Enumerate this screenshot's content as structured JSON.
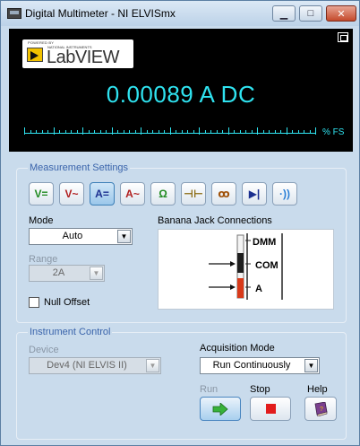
{
  "window": {
    "title": "Digital Multimeter - NI ELVISmx"
  },
  "display": {
    "logo_small": "POWERED BY",
    "logo_sub": "NATIONAL INSTRUMENTS",
    "logo_text": "LabVIEW",
    "reading": "0.00089 A DC",
    "fs_label": "% FS"
  },
  "measurement": {
    "title": "Measurement Settings",
    "buttons": [
      {
        "label": "V=",
        "color": "#1f8a1f"
      },
      {
        "label": "V~",
        "color": "#b01e1e"
      },
      {
        "label": "A=",
        "color": "#1b2f8f"
      },
      {
        "label": "A~",
        "color": "#b01e1e"
      },
      {
        "label": "Ω",
        "color": "#1f8a1f"
      },
      {
        "label": "⊣⊢",
        "color": "#8a6a10"
      },
      {
        "label": "ꝏ",
        "color": "#a0520a"
      },
      {
        "label": "▶|",
        "color": "#1b2f8f"
      },
      {
        "label": "·))",
        "color": "#2a7fd6"
      }
    ],
    "active_index": 2,
    "mode_label": "Mode",
    "mode_value": "Auto",
    "range_label": "Range",
    "range_value": "2A",
    "null_offset_label": "Null Offset",
    "jack_title": "Banana Jack Connections",
    "jack_labels": [
      "DMM",
      "COM",
      "A"
    ]
  },
  "instrument": {
    "title": "Instrument Control",
    "device_label": "Device",
    "device_value": "Dev4 (NI ELVIS II)",
    "acq_label": "Acquisition Mode",
    "acq_value": "Run Continuously",
    "run_label": "Run",
    "stop_label": "Stop",
    "help_label": "Help"
  }
}
